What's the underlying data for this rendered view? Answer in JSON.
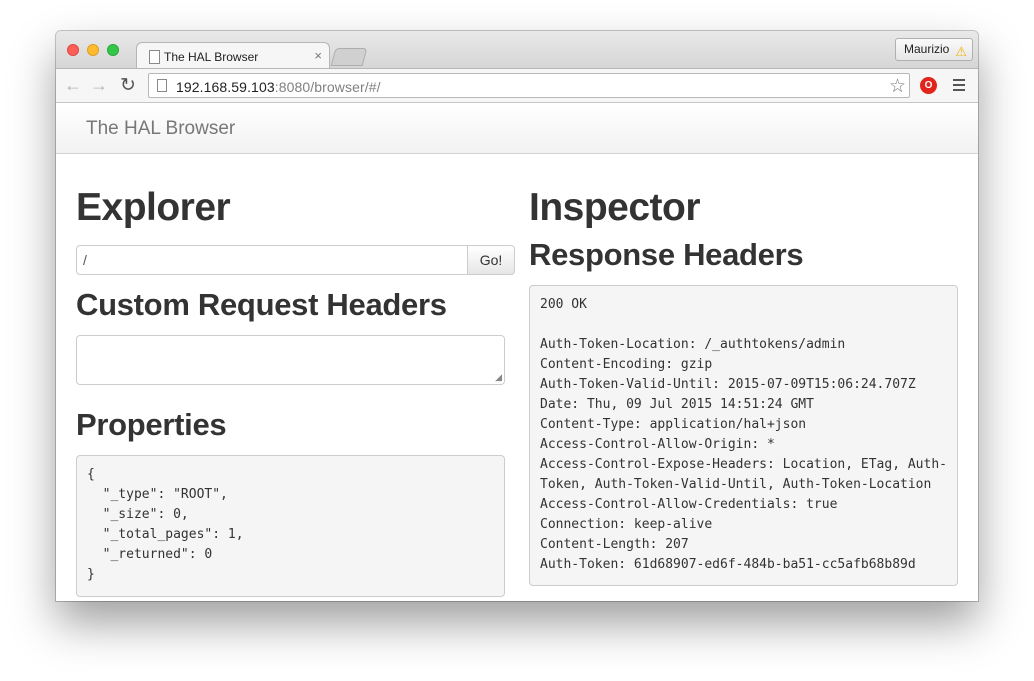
{
  "browser": {
    "tab_title": "The HAL Browser",
    "tab_close": "×",
    "profile_name": "Maurizio",
    "url_host": "192.168.59.103",
    "url_path": ":8080/browser/#/",
    "icons": {
      "back": "back-arrow-icon",
      "forward": "forward-arrow-icon",
      "reload": "reload-icon",
      "bookmark": "star-icon",
      "extension": "opera-extension-icon",
      "menu": "hamburger-menu-icon",
      "warning": "warning-icon"
    }
  },
  "navbar": {
    "brand": "The HAL Browser"
  },
  "explorer": {
    "title": "Explorer",
    "url_value": "/",
    "go_label": "Go!",
    "custom_headers_title": "Custom Request Headers",
    "custom_headers_value": "",
    "properties_title": "Properties",
    "properties_json": "{\n  \"_type\": \"ROOT\",\n  \"_size\": 0,\n  \"_total_pages\": 1,\n  \"_returned\": 0\n}"
  },
  "inspector": {
    "title": "Inspector",
    "response_headers_title": "Response Headers",
    "response_headers": "200 OK\n\nAuth-Token-Location: /_authtokens/admin\nContent-Encoding: gzip\nAuth-Token-Valid-Until: 2015-07-09T15:06:24.707Z\nDate: Thu, 09 Jul 2015 14:51:24 GMT\nContent-Type: application/hal+json\nAccess-Control-Allow-Origin: *\nAccess-Control-Expose-Headers: Location, ETag, Auth-\nToken, Auth-Token-Valid-Until, Auth-Token-Location\nAccess-Control-Allow-Credentials: true\nConnection: keep-alive\nContent-Length: 207\nAuth-Token: 61d68907-ed6f-484b-ba51-cc5afb68b89d"
  }
}
